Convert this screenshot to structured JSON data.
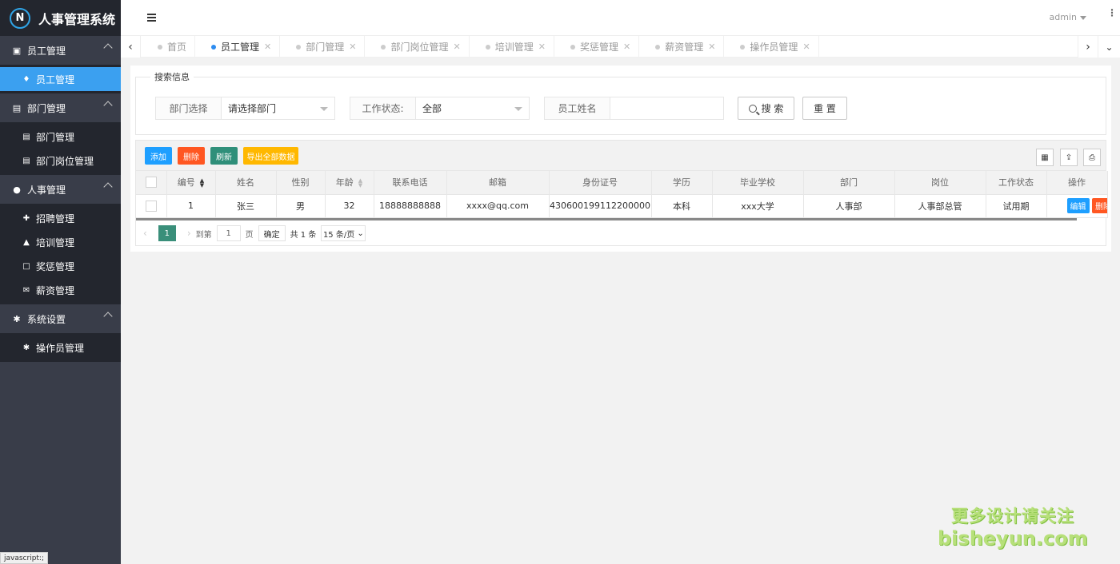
{
  "app": {
    "logo_letter": "N",
    "title": "人事管理系统"
  },
  "header": {
    "user": "admin",
    "more": "⋮"
  },
  "sidebar": {
    "groups": [
      {
        "label": "员工管理",
        "icon": "id-card-icon",
        "items": [
          {
            "label": "员工管理",
            "active": true
          }
        ]
      },
      {
        "label": "部门管理",
        "icon": "address-card-icon",
        "items": [
          {
            "label": "部门管理"
          },
          {
            "label": "部门岗位管理"
          }
        ]
      },
      {
        "label": "人事管理",
        "icon": "users-icon",
        "items": [
          {
            "label": "招聘管理"
          },
          {
            "label": "培训管理"
          },
          {
            "label": "奖惩管理"
          },
          {
            "label": "薪资管理"
          }
        ]
      },
      {
        "label": "系统设置",
        "icon": "gears-icon",
        "items": [
          {
            "label": "操作员管理"
          }
        ]
      }
    ]
  },
  "tabs": [
    {
      "label": "首页",
      "closable": false
    },
    {
      "label": "员工管理",
      "active": true
    },
    {
      "label": "部门管理"
    },
    {
      "label": "部门岗位管理"
    },
    {
      "label": "培训管理"
    },
    {
      "label": "奖惩管理"
    },
    {
      "label": "薪资管理"
    },
    {
      "label": "操作员管理"
    }
  ],
  "search": {
    "legend": "搜索信息",
    "dept_label": "部门选择",
    "dept_value": "请选择部门",
    "status_label": "工作状态:",
    "status_value": "全部",
    "name_label": "员工姓名",
    "name_value": "",
    "search_btn": "搜 索",
    "reset_btn": "重 置"
  },
  "toolbar": {
    "add": "添加",
    "delete": "删除",
    "refresh": "刷新",
    "export": "导出全部数据",
    "colors": {
      "add": "#1e9fff",
      "delete": "#ff5722",
      "refresh": "#2f8f7a",
      "export": "#ffb800"
    }
  },
  "table": {
    "columns": [
      "编号",
      "姓名",
      "性别",
      "年龄",
      "联系电话",
      "邮箱",
      "身份证号",
      "学历",
      "毕业学校",
      "部门",
      "岗位",
      "工作状态",
      "操作"
    ],
    "rows": [
      [
        "1",
        "张三",
        "男",
        "32",
        "18888888888",
        "xxxx@qq.com",
        "430600199112200000",
        "本科",
        "xxx大学",
        "人事部",
        "人事部总管",
        "试用期"
      ]
    ],
    "edit_btn": "编辑",
    "del_btn": "删除"
  },
  "pager": {
    "current": "1",
    "goto_label": "到第",
    "goto_value": "1",
    "page_unit": "页",
    "confirm": "确定",
    "total": "共 1 条",
    "page_size": "15 条/页"
  },
  "status_bar": "javascript:;",
  "watermark": {
    "line1": "更多设计请关注",
    "line2": "bisheyun.com"
  }
}
